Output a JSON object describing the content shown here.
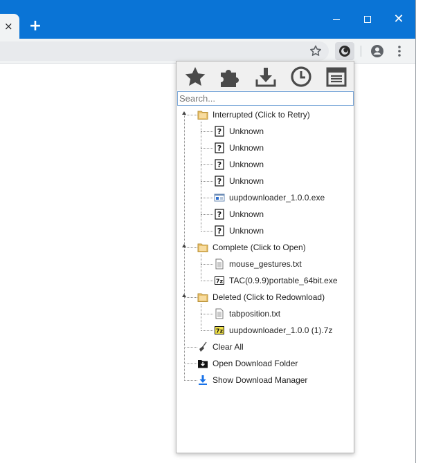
{
  "browser": {
    "tab_close": "×",
    "new_tab": "+",
    "window_close": "✕"
  },
  "popup": {
    "search_placeholder": "Search...",
    "groups": [
      {
        "label": "Interrupted (Click to Retry)",
        "items": [
          {
            "label": "Unknown",
            "icon": "unknown-file-icon"
          },
          {
            "label": "Unknown",
            "icon": "unknown-file-icon"
          },
          {
            "label": "Unknown",
            "icon": "unknown-file-icon"
          },
          {
            "label": "Unknown",
            "icon": "unknown-file-icon"
          },
          {
            "label": "uupdownloader_1.0.0.exe",
            "icon": "exe-file-icon"
          },
          {
            "label": "Unknown",
            "icon": "unknown-file-icon"
          },
          {
            "label": "Unknown",
            "icon": "unknown-file-icon"
          }
        ]
      },
      {
        "label": "Complete (Click to Open)",
        "items": [
          {
            "label": "mouse_gestures.txt",
            "icon": "text-file-icon"
          },
          {
            "label": "TAC(0.9.9)portable_64bit.exe",
            "icon": "7z-exe-file-icon"
          }
        ]
      },
      {
        "label": "Deleted (Click to Redownload)",
        "items": [
          {
            "label": "tabposition.txt",
            "icon": "text-file-icon"
          },
          {
            "label": "uupdownloader_1.0.0 (1).7z",
            "icon": "7z-file-icon"
          }
        ]
      }
    ],
    "actions": [
      {
        "label": "Clear All",
        "icon": "broom-icon"
      },
      {
        "label": "Open Download Folder",
        "icon": "download-folder-icon"
      },
      {
        "label": "Show Download Manager",
        "icon": "download-arrow-icon"
      }
    ],
    "toolbar_icons": [
      "star-icon",
      "puzzle-icon",
      "download-icon",
      "clock-icon",
      "notes-icon"
    ]
  }
}
